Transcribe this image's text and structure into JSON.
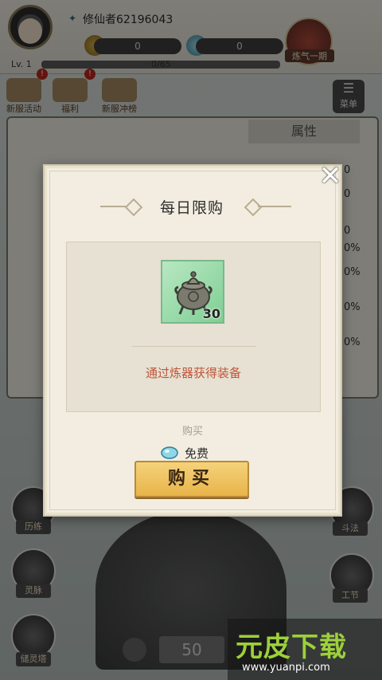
{
  "topbar": {
    "player_name": "修仙者62196043",
    "coin_value": "0",
    "gem_value": "0",
    "level_label": "Lv. 1",
    "exp_text": "0/65",
    "portrait_label": "炼气一期"
  },
  "menu": {
    "items": [
      {
        "label": "新服活动",
        "badge": "!"
      },
      {
        "label": "福利",
        "badge": "!"
      },
      {
        "label": "新服冲榜",
        "badge": ""
      }
    ],
    "menu_button_label": "菜单"
  },
  "panel": {
    "attr_title": "属性",
    "right_values": [
      "0",
      "0",
      "0",
      "0%",
      "0%",
      "0%",
      "0%"
    ]
  },
  "side_left": [
    "历练",
    "灵脉",
    "储灵塔"
  ],
  "side_right": [
    "斗法",
    "工节"
  ],
  "bottom": {
    "forge_number": "50"
  },
  "dialog": {
    "title": "每日限购",
    "item_count": "30",
    "description": "通过炼器获得装备",
    "buy_label": "购买",
    "price_text": "免费",
    "buy_button": "购买",
    "close_icon": "close-icon",
    "item_icon": "cauldron-icon"
  },
  "watermark": {
    "title": "元皮下载",
    "url": "www.yuanpi.com"
  },
  "colors": {
    "buy_button": "#e8b44a",
    "description": "#c0553a",
    "item_slot": "#7fcf94"
  }
}
